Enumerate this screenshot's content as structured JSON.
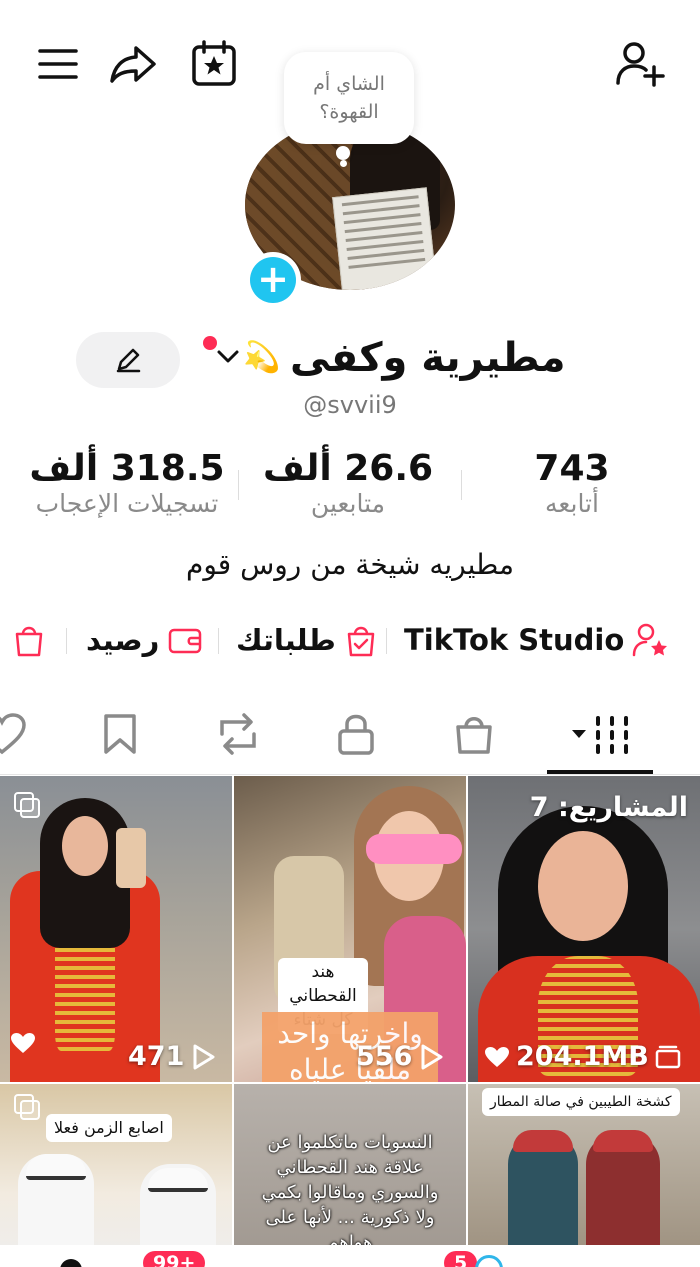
{
  "note": {
    "text": "الشاي أم القهوة؟"
  },
  "profile": {
    "display_name": "مطيرية وكفى",
    "name_emoji": "💫",
    "username": "@svvii9",
    "bio": "مطيريه شيخة من روس قوم"
  },
  "stats": {
    "following_count": "743",
    "following_label": "أتابعه",
    "followers_count": "26.6 ألف",
    "followers_label": "متابعين",
    "likes_count": "318.5 ألف",
    "likes_label": "تسجيلات الإعجاب"
  },
  "links": {
    "studio": "TikTok Studio",
    "orders": "طلباتك",
    "balance": "رصيد"
  },
  "tabs": [
    "videos",
    "shop",
    "private",
    "reposts",
    "favorites",
    "liked"
  ],
  "grid": {
    "items": [
      {
        "views": "471",
        "type": "multi-image"
      },
      {
        "views": "556",
        "caption": "هند القحطاني كل شتاء",
        "overlay": "واخرتها واحد ملقيا علياه"
      },
      {
        "size": "204.1MB",
        "projects_label": "المشاريع: 7"
      },
      {
        "caption": "اصابع الزمن فعلا"
      },
      {
        "caption": "النسويات ماتكلموا عن علاقة هند القحطاني والسوري وماقالوا بكمي ولا ذكورية ... لأنها على هواهم"
      },
      {
        "caption": "كشخة الطيبين في صالة المطار"
      }
    ]
  },
  "bottom_nav": {
    "inbox_badge": "99+",
    "profile_badge": "5"
  },
  "colors": {
    "accent": "#fe2c55",
    "avatar_add": "#20c5f0",
    "text_muted": "#8a8a8a"
  }
}
